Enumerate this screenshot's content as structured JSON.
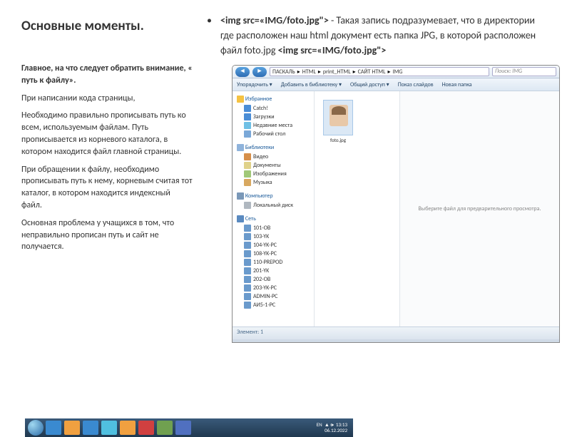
{
  "left": {
    "title": "Основные моменты.",
    "subtitle": "Главное, на что следует обратить внимание, « путь к файлу».",
    "p1": " При написании кода страницы,",
    "p2": "Необходимо правильно прописывать путь ко всем, используемым файлам. Путь прописывается из корневого каталога, в котором находится файл главной страницы.",
    "p3": " При  обращении к файлу, необходимо прописывать путь к нему, корневым считая тот каталог, в котором находится индексный файл.",
    "p4": " Основная проблема у учащихся  в том, что неправильно прописан путь и сайт не получается."
  },
  "right": {
    "code1": "<img src=«IMG/foto.jpg\">",
    "text": " - Такая запись подразумевает, что в директории где расположен наш html документ есть папка JPG,  в которой расположен файл foto.jpg ",
    "code2": "<img src=«IMG/foto.jpg\">"
  },
  "explorer": {
    "breadcrumb": [
      "ПАСКАЛЬ",
      "HTML",
      "print_HTML",
      "САЙТ HTML",
      "IMG"
    ],
    "search": "Поиск: IMG",
    "toolbar": [
      "Упорядочить ▾",
      "Добавить в библиотеку ▾",
      "Общий доступ ▾",
      "Показ слайдов",
      "Новая папка"
    ],
    "sidebar": {
      "fav": {
        "head": "Избранное",
        "items": [
          "Catch!",
          "Загрузки",
          "Недавние места",
          "Рабочий стол"
        ]
      },
      "lib": {
        "head": "Библиотеки",
        "items": [
          "Видео",
          "Документы",
          "Изображения",
          "Музыка"
        ]
      },
      "comp": {
        "head": "Компьютер",
        "items": [
          "Локальный диск"
        ]
      },
      "net": {
        "head": "Сеть",
        "items": [
          "101-OB",
          "103-YK",
          "104-YK-PC",
          "108-YK-PC",
          "110-PREPOD",
          "201-YK",
          "202-OB",
          "203-YK-PC",
          "ADMIN-PC",
          "АИ5-1-PC"
        ]
      }
    },
    "file": "foto.jpg",
    "preview": "Выберите файл для предварительного просмотра.",
    "status": "Элемент: 1",
    "tray": {
      "lang": "EN",
      "time": "13:13",
      "date": "06.12.2022"
    }
  }
}
